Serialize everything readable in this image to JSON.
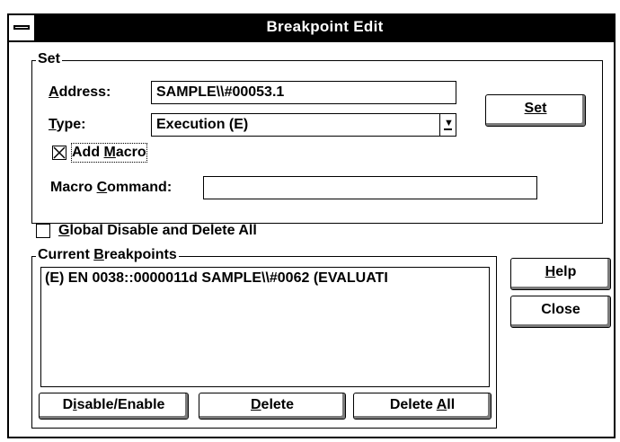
{
  "window": {
    "title": "Breakpoint Edit"
  },
  "set_group": {
    "legend": "Set",
    "address_label": "Address:",
    "address_value": "SAMPLE\\\\#00053.1",
    "type_label": "Type:",
    "type_value": "Execution (E)",
    "add_macro_label": "Add Macro",
    "add_macro_checked": true,
    "macro_command_label": "Macro Command:",
    "macro_command_value": "",
    "set_button": "Set"
  },
  "global_disable": {
    "label": "Global Disable and Delete All",
    "checked": false
  },
  "current_group": {
    "legend": "Current Breakpoints",
    "items": [
      "(E)  EN 0038::0000011d SAMPLE\\\\#0062 (EVALUATI"
    ]
  },
  "buttons": {
    "help": "Help",
    "close": "Close",
    "disable_enable": "Disable/Enable",
    "delete": "Delete",
    "delete_all": "Delete All"
  }
}
